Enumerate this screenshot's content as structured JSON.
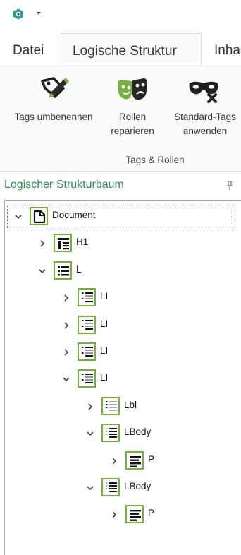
{
  "window": {
    "app_icon": "app-logo-icon",
    "quick_access_dropdown": "chevron-down-icon"
  },
  "tabs": [
    {
      "label": "Datei"
    },
    {
      "label": "Logische Struktur",
      "active": true
    },
    {
      "label": "Inha"
    }
  ],
  "ribbon": {
    "buttons": [
      {
        "label_lines": [
          "Tags umbenennen"
        ],
        "icon": "rename-tags-icon"
      },
      {
        "label_lines": [
          "Rollen",
          "reparieren"
        ],
        "icon": "repair-roles-icon"
      },
      {
        "label_lines": [
          "Standard-Tags",
          "anwenden"
        ],
        "icon": "apply-standard-tags-icon"
      }
    ],
    "group_label": "Tags & Rollen"
  },
  "panel": {
    "title": "Logischer Strukturbaum",
    "pin_icon": "pin-icon"
  },
  "tree": [
    {
      "label": "Document",
      "state": "expanded",
      "icon": "document-icon",
      "selected": true
    },
    {
      "label": "H1",
      "state": "collapsed",
      "icon": "heading-icon"
    },
    {
      "label": "L",
      "state": "expanded",
      "icon": "list-icon"
    },
    {
      "label": "LI",
      "state": "collapsed",
      "icon": "list-item-icon"
    },
    {
      "label": "LI",
      "state": "collapsed",
      "icon": "list-item-icon"
    },
    {
      "label": "LI",
      "state": "collapsed",
      "icon": "list-item-icon"
    },
    {
      "label": "LI",
      "state": "expanded",
      "icon": "list-item-icon"
    },
    {
      "label": "Lbl",
      "state": "collapsed",
      "icon": "list-label-icon"
    },
    {
      "label": "LBody",
      "state": "expanded",
      "icon": "list-body-icon"
    },
    {
      "label": "P",
      "state": "collapsed",
      "icon": "paragraph-icon"
    },
    {
      "label": "LBody",
      "state": "expanded",
      "icon": "list-body-icon"
    },
    {
      "label": "P",
      "state": "collapsed",
      "icon": "paragraph-icon"
    }
  ],
  "colors": {
    "accent_green": "#76b041",
    "panel_title": "#2e8b57"
  }
}
